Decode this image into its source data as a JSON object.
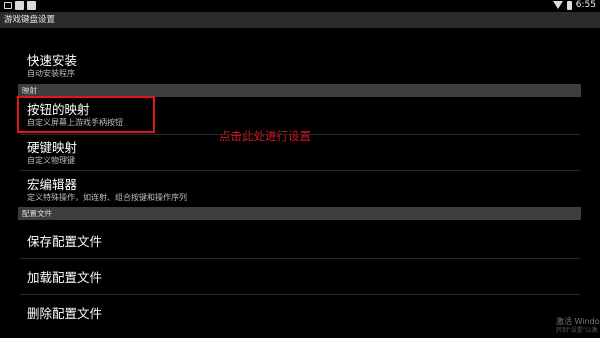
{
  "status_bar": {
    "time": "6:55",
    "icons": [
      "screenshot-icon",
      "app-icon",
      "app-icon",
      "wifi-icon",
      "battery-icon"
    ]
  },
  "app": {
    "title": "游戏键盘设置"
  },
  "items": {
    "quick_install": {
      "title": "快速安装",
      "subtitle": "自动安装程序"
    },
    "button_mapping": {
      "title": "按钮的映射",
      "subtitle": "自定义屏幕上游戏手柄按钮"
    },
    "hardkey_mapping": {
      "title": "硬键映射",
      "subtitle": "自定义物理键"
    },
    "macro_editor": {
      "title": "宏编辑器",
      "subtitle": "定义特殊操作，如连射、组合按键和操作序列"
    },
    "save_config": {
      "title": "保存配置文件"
    },
    "load_config": {
      "title": "加载配置文件"
    },
    "delete_config": {
      "title": "删除配置文件"
    }
  },
  "sections": {
    "mapping": "映射",
    "config_file": "配置文件"
  },
  "annotation": {
    "text": "点击此处进行设置",
    "color": "#e0141b"
  },
  "watermark": {
    "line1": "激活 Windo",
    "line2": "转到\"设置\"以激"
  }
}
